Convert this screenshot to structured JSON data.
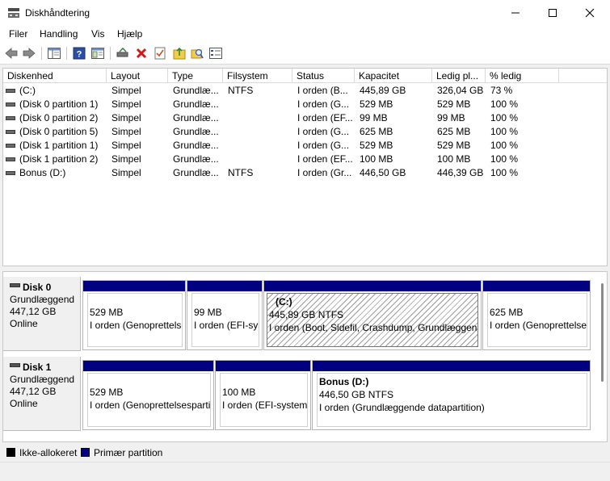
{
  "window": {
    "title": "Diskhåndtering"
  },
  "menu": [
    "Filer",
    "Handling",
    "Vis",
    "Hjælp"
  ],
  "toolbar_icons": [
    "back-arrow-icon",
    "forward-arrow-icon",
    "properties-pane-icon",
    "help-icon",
    "console-tree-icon",
    "connect-drive-icon",
    "delete-icon",
    "checklist-icon",
    "import-folder-icon",
    "search-folder-icon",
    "settings-list-icon"
  ],
  "columns": [
    "Diskenhed",
    "Layout",
    "Type",
    "Filsystem",
    "Status",
    "Kapacitet",
    "Ledig pl...",
    "% ledig"
  ],
  "volumes": [
    {
      "name": "(C:)",
      "layout": "Simpel",
      "type": "Grundlæ...",
      "fs": "NTFS",
      "status": "I orden (B...",
      "capacity": "445,89 GB",
      "free": "326,04 GB",
      "pct": "73 %"
    },
    {
      "name": "(Disk 0 partition 1)",
      "layout": "Simpel",
      "type": "Grundlæ...",
      "fs": "",
      "status": "I orden (G...",
      "capacity": "529 MB",
      "free": "529 MB",
      "pct": "100 %"
    },
    {
      "name": "(Disk 0 partition 2)",
      "layout": "Simpel",
      "type": "Grundlæ...",
      "fs": "",
      "status": "I orden (EF...",
      "capacity": "99 MB",
      "free": "99 MB",
      "pct": "100 %"
    },
    {
      "name": "(Disk 0 partition 5)",
      "layout": "Simpel",
      "type": "Grundlæ...",
      "fs": "",
      "status": "I orden (G...",
      "capacity": "625 MB",
      "free": "625 MB",
      "pct": "100 %"
    },
    {
      "name": "(Disk 1 partition 1)",
      "layout": "Simpel",
      "type": "Grundlæ...",
      "fs": "",
      "status": "I orden (G...",
      "capacity": "529 MB",
      "free": "529 MB",
      "pct": "100 %"
    },
    {
      "name": "(Disk 1 partition 2)",
      "layout": "Simpel",
      "type": "Grundlæ...",
      "fs": "",
      "status": "I orden (EF...",
      "capacity": "100 MB",
      "free": "100 MB",
      "pct": "100 %"
    },
    {
      "name": "Bonus (D:)",
      "layout": "Simpel",
      "type": "Grundlæ...",
      "fs": "NTFS",
      "status": "I orden (Gr...",
      "capacity": "446,50 GB",
      "free": "446,39 GB",
      "pct": "100 %"
    }
  ],
  "disks": [
    {
      "name": "Disk 0",
      "type": "Grundlæggend",
      "size": "447,12 GB",
      "state": "Online",
      "partitions": [
        {
          "name": "",
          "size": "529 MB",
          "status": "I orden (Genoprettelsespartition)"
        },
        {
          "name": "",
          "size": "99 MB",
          "status": "I orden (EFI-systempartition)"
        },
        {
          "name": "(C:)",
          "size": "445,89 GB NTFS",
          "status": "I orden (Boot, Sidefil, Crashdump, Grundlæggende datapartition)"
        },
        {
          "name": "",
          "size": "625 MB",
          "status": "I orden (Genoprettelsespartition)"
        }
      ]
    },
    {
      "name": "Disk 1",
      "type": "Grundlæggend",
      "size": "447,12 GB",
      "state": "Online",
      "partitions": [
        {
          "name": "",
          "size": "529 MB",
          "status": "I orden (Genoprettelsespartition)"
        },
        {
          "name": "",
          "size": "100 MB",
          "status": "I orden (EFI-systempartition)"
        },
        {
          "name": "Bonus  (D:)",
          "size": "446,50 GB NTFS",
          "status": "I orden (Grundlæggende datapartition)"
        }
      ]
    }
  ],
  "legend": [
    {
      "label": "Ikke-allokeret",
      "color": "#000000"
    },
    {
      "label": "Primær partition",
      "color": "#000080"
    }
  ]
}
